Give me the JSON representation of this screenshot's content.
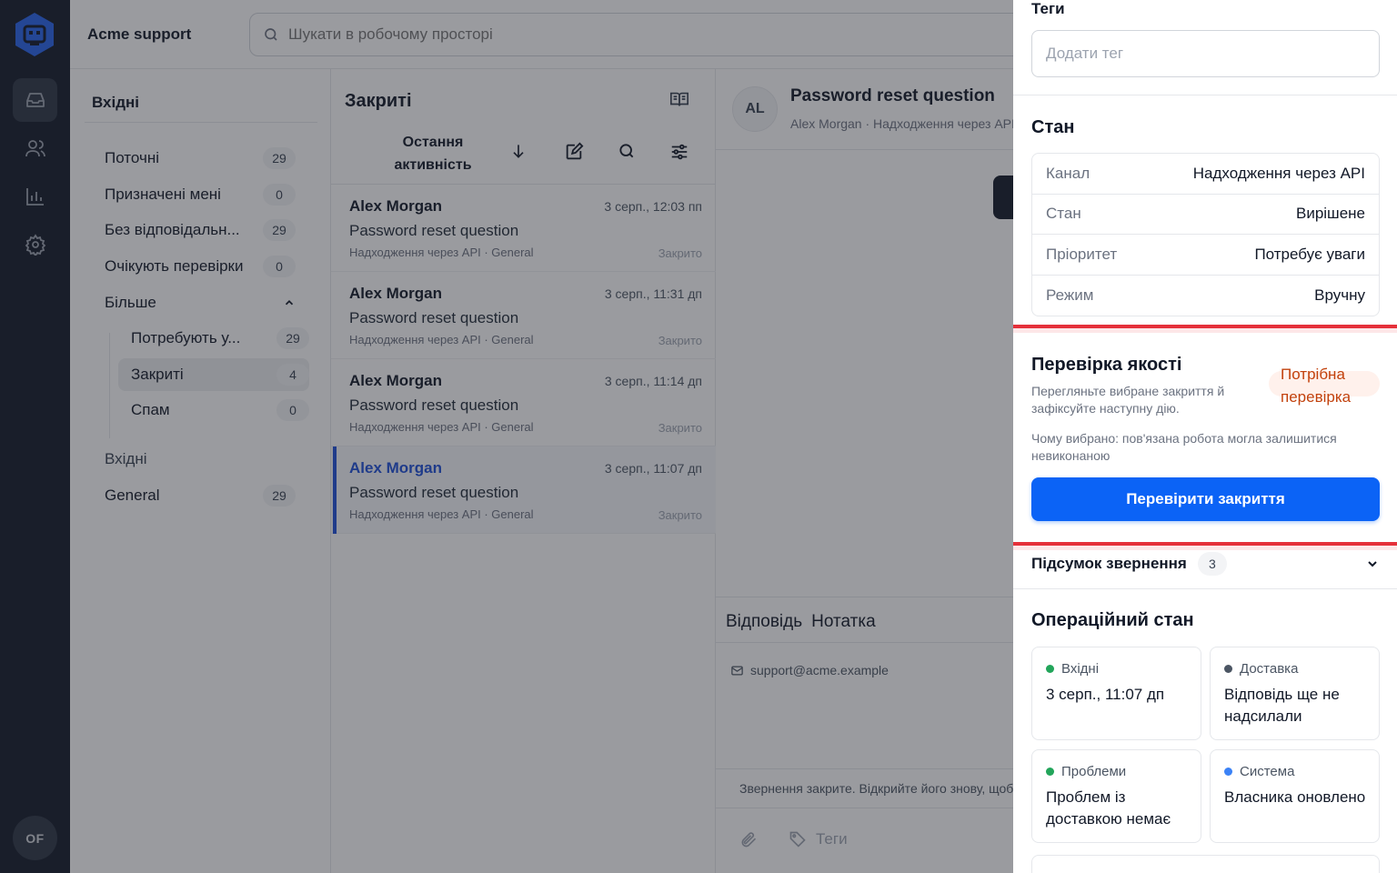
{
  "rail": {
    "avatar_initials": "OF"
  },
  "topbar": {
    "workspace_name": "Acme support",
    "search_placeholder": "Шукати в робочому просторі"
  },
  "folders": {
    "heading": "Вхідні",
    "items": [
      {
        "label": "Поточні",
        "count": "29"
      },
      {
        "label": "Призначені мені",
        "count": "0"
      },
      {
        "label": "Без відповідальн...",
        "count": "29"
      },
      {
        "label": "Очікують перевірки",
        "count": "0"
      }
    ],
    "more_label": "Більше",
    "sub_items": [
      {
        "label": "Потребують у...",
        "count": "29"
      },
      {
        "label": "Закриті",
        "count": "4"
      },
      {
        "label": "Спам",
        "count": "0"
      }
    ],
    "inboxes_label": "Вхідні",
    "inboxes": [
      {
        "label": "General",
        "count": "29"
      }
    ]
  },
  "list": {
    "title": "Закриті",
    "sort_label": "Остання активність",
    "conversations": [
      {
        "name": "Alex Morgan",
        "time": "3 серп., 12:03 пп",
        "subject": "Password reset question",
        "meta": "Надходження через API · General",
        "status": "Закрито"
      },
      {
        "name": "Alex Morgan",
        "time": "3 серп., 11:31 дп",
        "subject": "Password reset question",
        "meta": "Надходження через API · General",
        "status": "Закрито"
      },
      {
        "name": "Alex Morgan",
        "time": "3 серп., 11:14 дп",
        "subject": "Password reset question",
        "meta": "Надходження через API · General",
        "status": "Закрито"
      },
      {
        "name": "Alex Morgan",
        "time": "3 серп., 11:07 дп",
        "subject": "Password reset question",
        "meta": "Надходження через API · General",
        "status": "Закрито"
      }
    ]
  },
  "detail": {
    "avatar_initials": "AL",
    "subject": "Password reset question",
    "subline": "Alex Morgan · Надходження через API",
    "composer": {
      "tab_reply": "Відповідь",
      "tab_note": "Нотатка",
      "from_address": "support@acme.example",
      "closed_notice": "Звернення закрите. Відкрийте його знову, щоб відповісти.",
      "tags_label": "Теги"
    }
  },
  "panel": {
    "tags_label": "Теги",
    "tags_placeholder": "Додати тег",
    "state_title": "Стан",
    "state_rows": [
      {
        "key": "Канал",
        "value": "Надходження через API"
      },
      {
        "key": "Стан",
        "value": "Вирішене"
      },
      {
        "key": "Пріоритет",
        "value": "Потребує уваги"
      },
      {
        "key": "Режим",
        "value": "Вручну"
      }
    ],
    "qa": {
      "title": "Перевірка якості",
      "description": "Перегляньте вибране закриття й зафіксуйте наступну дію.",
      "badge": "Потрібна перевірка",
      "reason": "Чому вибрано: пов'язана робота могла залишитися невиконаною",
      "button": "Перевірити закриття"
    },
    "summary": {
      "title": "Підсумок звернення",
      "count": "3"
    },
    "ops": {
      "title": "Операційний стан",
      "cards": [
        {
          "label": "Вхідні",
          "value": "3 серп., 11:07 дп",
          "dot_color": "#22a55a"
        },
        {
          "label": "Доставка",
          "value": "Відповідь ще не надсилали",
          "dot_color": "#4b5563"
        },
        {
          "label": "Проблеми",
          "value": "Проблем із доставкою немає",
          "dot_color": "#22a55a"
        },
        {
          "label": "Система",
          "value": "Власника оновлено",
          "dot_color": "#3b82f6"
        }
      ]
    }
  },
  "colors": {
    "accent": "#0b63f6",
    "selected_conversation": "#1d4ed8",
    "badge_warning": "#c2410c",
    "highlight_rule": "#e5303a"
  }
}
